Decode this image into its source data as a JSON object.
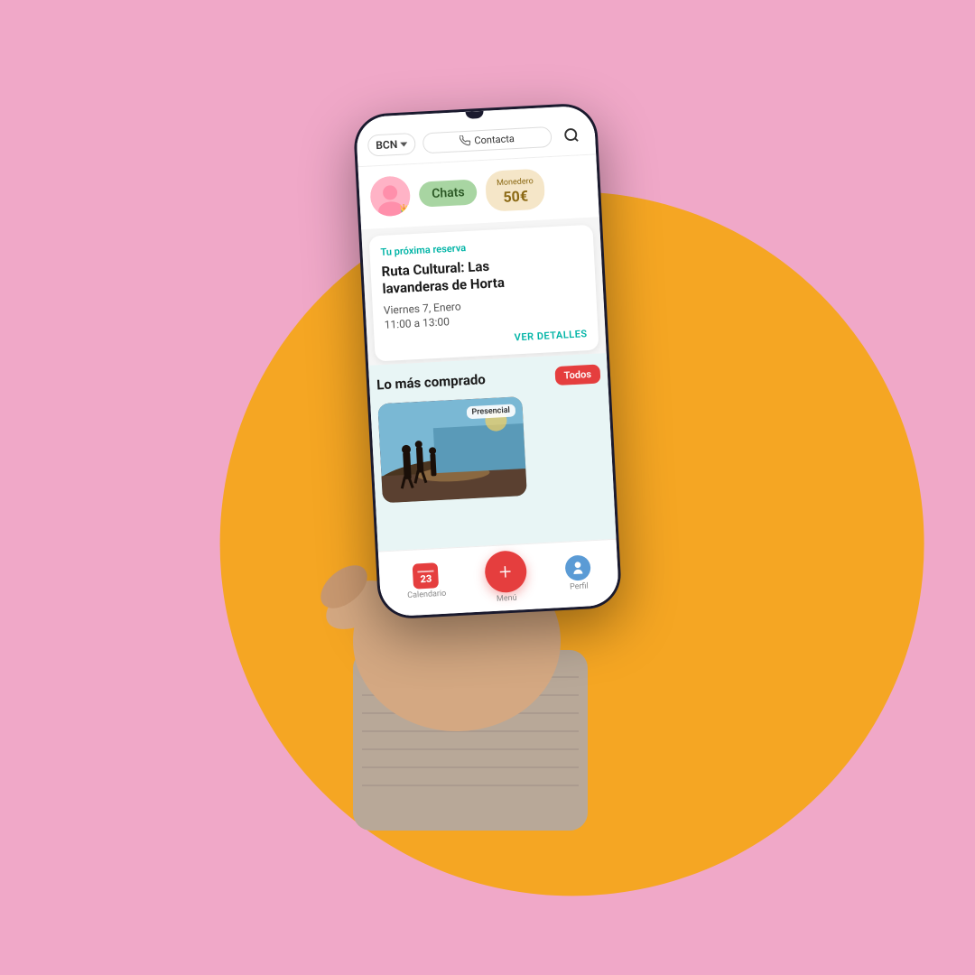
{
  "background": {
    "outer_color": "#f0a8c8",
    "circle_color": "#f5a623"
  },
  "phone": {
    "header": {
      "location": "BCN",
      "contact_button": "Contacta",
      "has_search": true
    },
    "profile": {
      "chats_label": "Chats",
      "monedero_label": "Monedero",
      "monedero_amount": "50€"
    },
    "reservation": {
      "section_label": "Tu próxima reserva",
      "title_line1": "Ruta Cultural: Las",
      "title_line2": "lavanderas de Horta",
      "date": "Viernes 7, Enero",
      "time": "11:00 a 13:00",
      "cta": "VER DETALLES"
    },
    "featured": {
      "section_title": "Lo más comprado",
      "filter_button": "Todos",
      "card_badge": "Presencial"
    },
    "bottom_nav": {
      "calendar_label": "Calendario",
      "calendar_date": "23",
      "menu_label": "Menú",
      "profile_label": "Perfil"
    }
  }
}
